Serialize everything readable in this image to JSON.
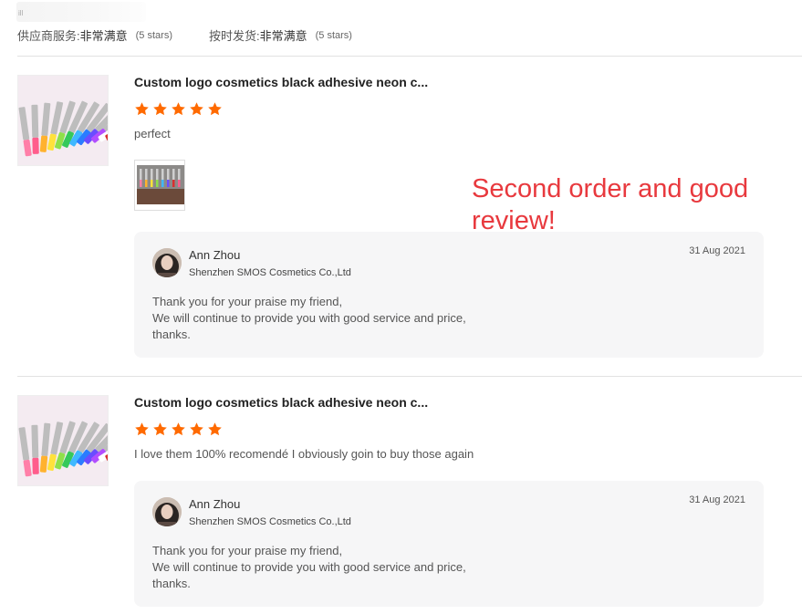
{
  "store_ratings": [
    {
      "label": "供应商服务: ",
      "value": "非常满意",
      "stars": "(5 stars)"
    },
    {
      "label": "按时发货: ",
      "value": "非常满意",
      "stars": "(5 stars)"
    }
  ],
  "reviews": [
    {
      "product_title": "Custom logo cosmetics black adhesive neon c...",
      "rating": 5,
      "comment": "perfect",
      "has_photo": true,
      "reply": {
        "seller_name": "Ann Zhou",
        "company": "Shenzhen SMOS Cosmetics Co.,Ltd",
        "date": "31 Aug 2021",
        "lines": [
          "Thank you for your praise my friend,",
          "We will continue to provide you with good service and price,",
          "thanks."
        ]
      }
    },
    {
      "product_title": "Custom logo cosmetics black adhesive neon c...",
      "rating": 5,
      "comment": "I love them 100% recomendé I obviously goin to buy those again",
      "has_photo": false,
      "reply": {
        "seller_name": "Ann Zhou",
        "company": "Shenzhen SMOS Cosmetics Co.,Ltd",
        "date": "31 Aug 2021",
        "lines": [
          "Thank you for your praise my friend,",
          "We will continue to provide you with good service and price,",
          "thanks."
        ]
      }
    }
  ],
  "annotation": {
    "lines": [
      "Second order and good",
      "review!"
    ]
  },
  "colors": {
    "star": "#ff6a00",
    "annotation": "#e8393e",
    "reply_bg": "#f6f6f7"
  },
  "icons": {
    "star": "star-icon",
    "avatar": "seller-avatar"
  }
}
